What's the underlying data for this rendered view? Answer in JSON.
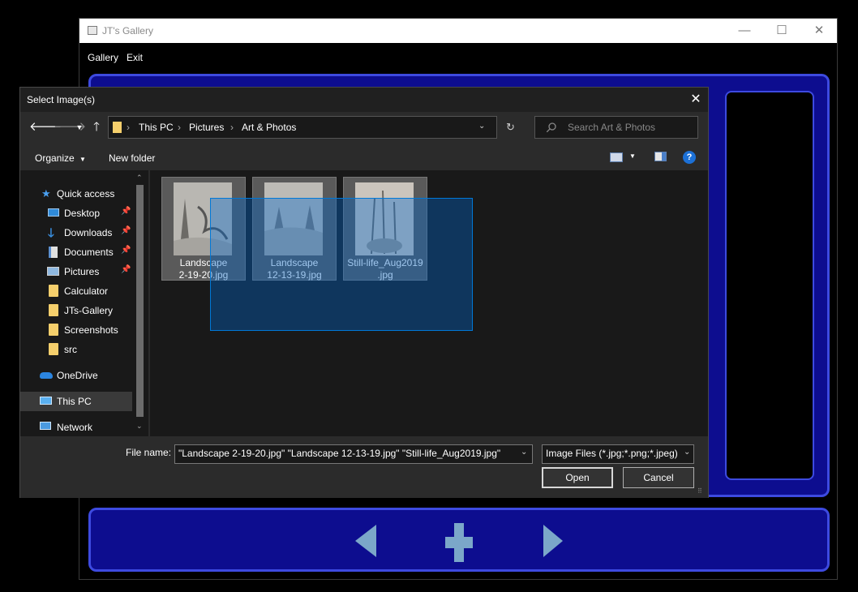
{
  "gallery": {
    "title": "JT's Gallery",
    "menu": [
      "Gallery",
      "Exit"
    ],
    "controls": {
      "minimize": "—",
      "maximize": "☐",
      "close": "✕"
    },
    "colors": {
      "frame_fill": "#0d0d8f",
      "frame_border": "#3d4ae0",
      "nav_icon": "#7ba7c9"
    }
  },
  "dialog": {
    "title": "Select Image(s)",
    "close": "✕",
    "breadcrumb": [
      "This PC",
      "Pictures",
      "Art & Photos"
    ],
    "search_placeholder": "Search Art & Photos",
    "toolbar": {
      "organize": "Organize",
      "new_folder": "New folder"
    },
    "sidebar": [
      {
        "label": "Quick access",
        "icon": "star-icon",
        "pinned": false
      },
      {
        "label": "Desktop",
        "icon": "desktop-icon",
        "pinned": true
      },
      {
        "label": "Downloads",
        "icon": "download-arrow-icon",
        "pinned": true
      },
      {
        "label": "Documents",
        "icon": "documents-icon",
        "pinned": true
      },
      {
        "label": "Pictures",
        "icon": "pictures-icon",
        "pinned": true
      },
      {
        "label": "Calculator",
        "icon": "folder-icon",
        "pinned": false
      },
      {
        "label": "JTs-Gallery",
        "icon": "folder-icon",
        "pinned": false
      },
      {
        "label": "Screenshots",
        "icon": "folder-icon",
        "pinned": false
      },
      {
        "label": "src",
        "icon": "folder-icon",
        "pinned": false
      },
      {
        "label": "OneDrive",
        "icon": "cloud-icon",
        "pinned": false
      },
      {
        "label": "This PC",
        "icon": "computer-icon",
        "pinned": false
      },
      {
        "label": "Network",
        "icon": "network-icon",
        "pinned": false
      }
    ],
    "files": [
      {
        "line1": "Landscape",
        "line2": "2-19-20.jpg"
      },
      {
        "line1": "Landscape",
        "line2": "12-13-19.jpg"
      },
      {
        "line1": "Still-life_Aug2019",
        "line2": ".jpg"
      }
    ],
    "file_name_label": "File name:",
    "file_name_value": "\"Landscape 2-19-20.jpg\" \"Landscape 12-13-19.jpg\" \"Still-life_Aug2019.jpg\"",
    "file_type_filter": "Image Files (*.jpg;*.png;*.jpeg)",
    "open_label": "Open",
    "cancel_label": "Cancel"
  }
}
